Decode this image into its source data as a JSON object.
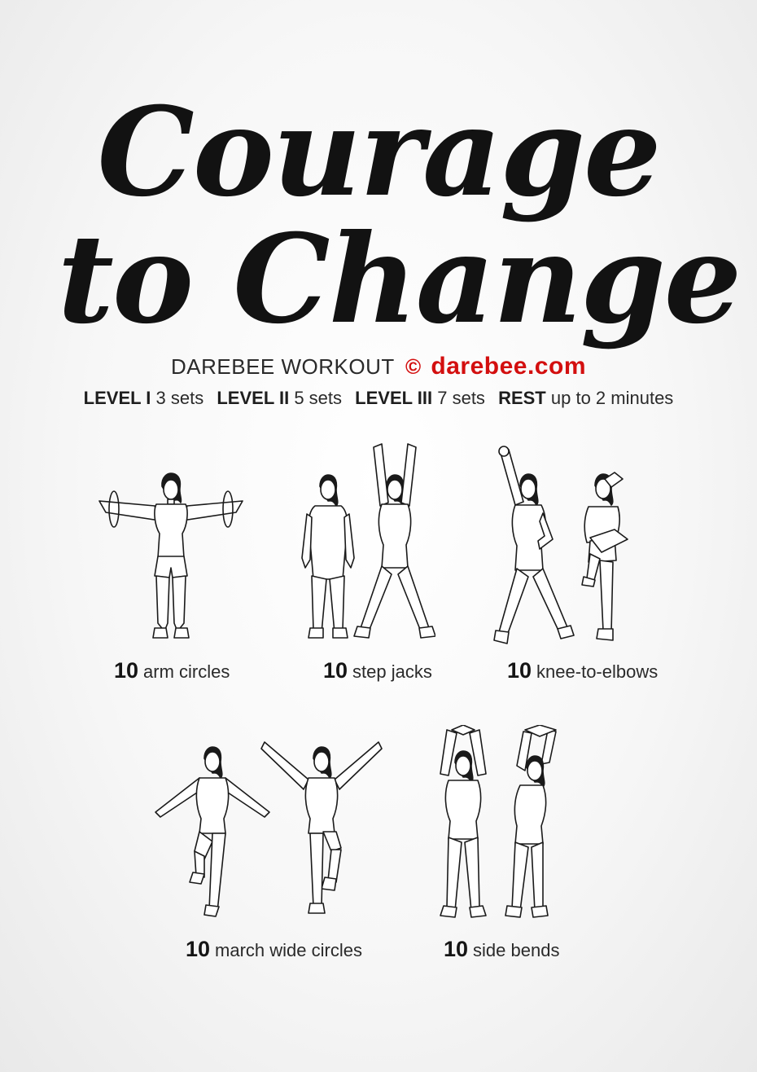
{
  "title": {
    "line1": "Courage",
    "line2": "to Change"
  },
  "subtitle": {
    "text": "DAREBEE WORKOUT",
    "copyright": "©",
    "site": "darebee.com"
  },
  "levels": [
    {
      "label": "LEVEL I",
      "value": "3 sets"
    },
    {
      "label": "LEVEL II",
      "value": "5 sets"
    },
    {
      "label": "LEVEL III",
      "value": "7 sets"
    },
    {
      "label": "REST",
      "value": "up to 2 minutes"
    }
  ],
  "exercises": [
    {
      "count": "10",
      "name": "arm circles"
    },
    {
      "count": "10",
      "name": "step jacks"
    },
    {
      "count": "10",
      "name": "knee-to-elbows"
    },
    {
      "count": "10",
      "name": "march wide circles"
    },
    {
      "count": "10",
      "name": "side bends"
    }
  ],
  "colors": {
    "accent": "#d30f0f",
    "text": "#1c1c1c",
    "background": "#f5f5f5"
  }
}
